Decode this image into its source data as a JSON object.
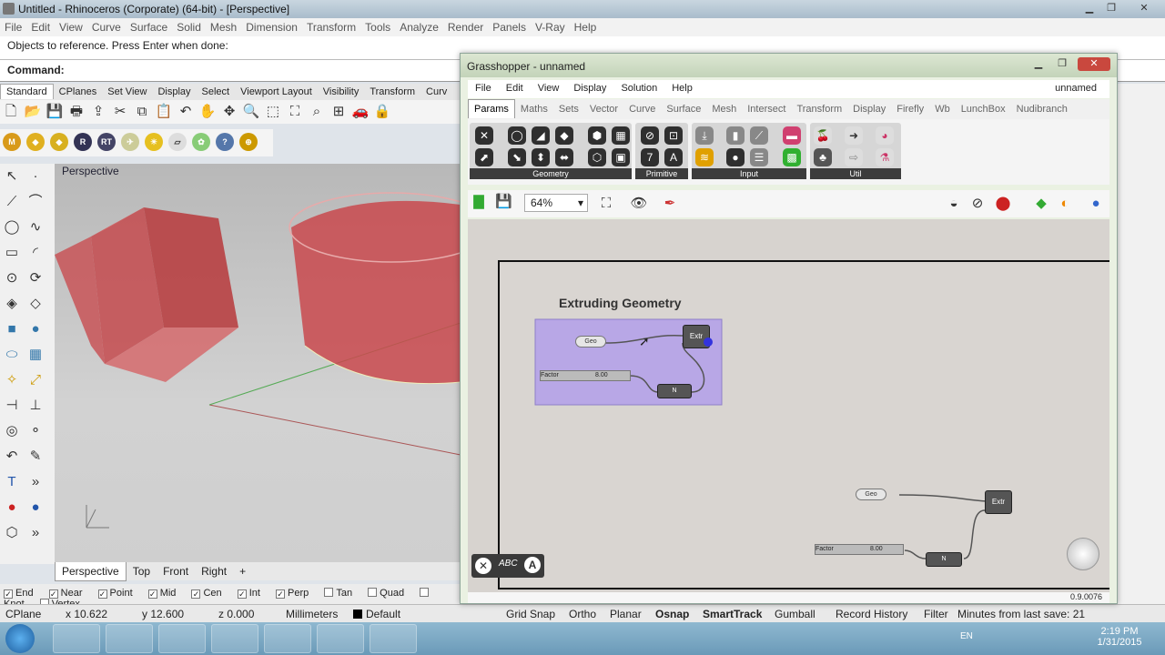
{
  "rhino": {
    "title": "Untitled - Rhinoceros (Corporate) (64-bit) - [Perspective]",
    "menu": [
      "File",
      "Edit",
      "View",
      "Curve",
      "Surface",
      "Solid",
      "Mesh",
      "Dimension",
      "Transform",
      "Tools",
      "Analyze",
      "Render",
      "Panels",
      "V-Ray",
      "Help"
    ],
    "command_history": "Objects to reference. Press Enter when done:",
    "command_prompt": "Command:",
    "toolbar_tabs": [
      "Standard",
      "CPlanes",
      "Set View",
      "Display",
      "Select",
      "Viewport Layout",
      "Visibility",
      "Transform",
      "Curv"
    ],
    "viewport_label": "Perspective",
    "view_tabs": [
      "Perspective",
      "Top",
      "Front",
      "Right",
      "+"
    ],
    "osnaps": [
      {
        "label": "End",
        "checked": true
      },
      {
        "label": "Near",
        "checked": true
      },
      {
        "label": "Point",
        "checked": true
      },
      {
        "label": "Mid",
        "checked": true
      },
      {
        "label": "Cen",
        "checked": true
      },
      {
        "label": "Int",
        "checked": true
      },
      {
        "label": "Perp",
        "checked": true
      },
      {
        "label": "Tan",
        "checked": false
      },
      {
        "label": "Quad",
        "checked": false
      },
      {
        "label": "Knot",
        "checked": false
      },
      {
        "label": "Vertex",
        "checked": false
      }
    ],
    "status": {
      "cplane": "CPlane",
      "x": "x 10.622",
      "y": "y 12.600",
      "z": "z 0.000",
      "units": "Millimeters",
      "layer": "Default",
      "grid_snap": "Grid Snap",
      "ortho": "Ortho",
      "planar": "Planar",
      "osnap": "Osnap",
      "smarttrack": "SmartTrack",
      "gumball": "Gumball",
      "record_history": "Record History",
      "filter": "Filter",
      "minutes": "Minutes from last save: 21"
    }
  },
  "grasshopper": {
    "title": "Grasshopper - unnamed",
    "menu": [
      "File",
      "Edit",
      "View",
      "Display",
      "Solution",
      "Help"
    ],
    "doc_name": "unnamed",
    "tabs": [
      "Params",
      "Maths",
      "Sets",
      "Vector",
      "Curve",
      "Surface",
      "Mesh",
      "Intersect",
      "Transform",
      "Display",
      "Firefly",
      "Wb",
      "LunchBox",
      "Nudibranch"
    ],
    "groups": [
      "Geometry",
      "Primitive",
      "Input",
      "Util"
    ],
    "zoom": "64%",
    "group_title": "Extruding Geometry",
    "geo_label": "Geo",
    "factor_label": "Factor",
    "slider_value": "8.00",
    "extrude_label": "Extr",
    "unit_label": "N",
    "version": "0.9.0076"
  },
  "taskbar": {
    "lang": "EN",
    "time": "2:19 PM",
    "date": "1/31/2015"
  },
  "colors": {
    "group_fill": "#b8a7e6",
    "shape_red": "#c8464a",
    "canvas": "#d7d3cf"
  }
}
